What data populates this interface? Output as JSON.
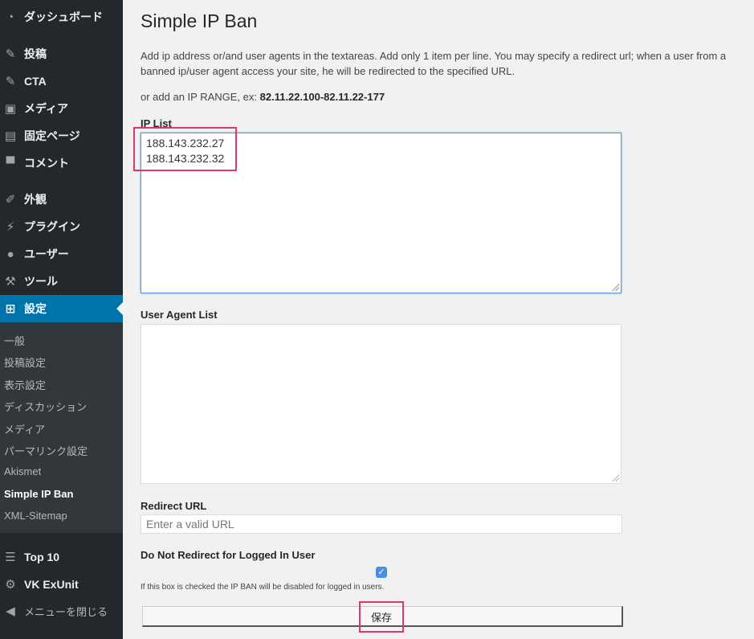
{
  "sidebar": {
    "items": [
      {
        "label": "ダッシュボード",
        "icon": "dashboard-icon"
      },
      {
        "label": "投稿",
        "icon": "pin-icon"
      },
      {
        "label": "CTA",
        "icon": "pin-icon"
      },
      {
        "label": "メディア",
        "icon": "media-icon"
      },
      {
        "label": "固定ページ",
        "icon": "page-icon"
      },
      {
        "label": "コメント",
        "icon": "comment-icon"
      },
      {
        "label": "外観",
        "icon": "brush-icon"
      },
      {
        "label": "プラグイン",
        "icon": "plugin-icon"
      },
      {
        "label": "ユーザー",
        "icon": "user-icon"
      },
      {
        "label": "ツール",
        "icon": "wrench-icon"
      },
      {
        "label": "設定",
        "icon": "settings-icon"
      }
    ],
    "submenu": [
      "一般",
      "投稿設定",
      "表示設定",
      "ディスカッション",
      "メディア",
      "パーマリンク設定",
      "Akismet",
      "Simple IP Ban",
      "XML-Sitemap"
    ],
    "bottom_items": [
      {
        "label": "Top 10",
        "icon": "list-icon"
      },
      {
        "label": "VK ExUnit",
        "icon": "gear-icon"
      },
      {
        "label": "メニューを閉じる",
        "icon": "collapse-icon"
      }
    ]
  },
  "page": {
    "title": "Simple IP Ban",
    "description": "Add ip address or/and user agents in the textareas. Add only 1 item per line. You may specify a redirect url; when a user from a banned ip/user agent access your site, he will be redirected to the specified URL.",
    "range_prefix": "or add an IP RANGE, ex: ",
    "range_example": "82.11.22.100-82.11.22-177",
    "ip_list_label": "IP List",
    "ip_list": [
      "188.143.232.27",
      "188.143.232.32"
    ],
    "user_agent_label": "User Agent List",
    "redirect_label": "Redirect URL",
    "redirect_placeholder": "Enter a valid URL",
    "logged_in_label": "Do Not Redirect for Logged In User",
    "checkbox_checked": true,
    "note": "If this box is checked the IP BAN will be disabled for logged in users.",
    "save_label": "保存"
  },
  "colors": {
    "highlight": "#e6336b",
    "active": "#0073aa",
    "sidebar": "#23282d"
  }
}
